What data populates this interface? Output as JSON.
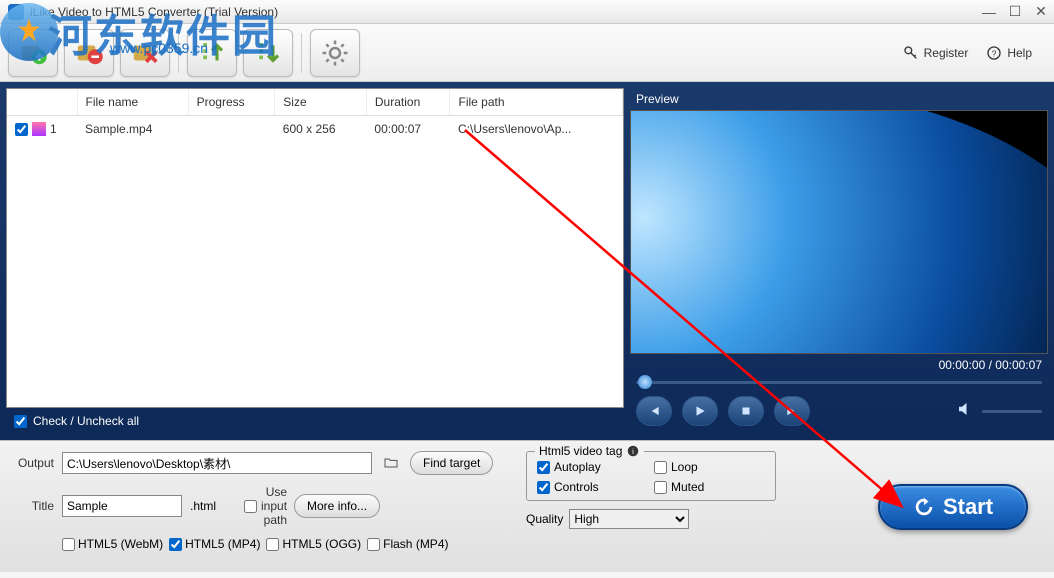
{
  "window": {
    "title": "iLike Video to HTML5 Converter (Trial Version)"
  },
  "watermark": {
    "text": "河东软件园",
    "url": "www.pc0359.cn"
  },
  "toolbar_links": {
    "register": "Register",
    "help": "Help"
  },
  "table": {
    "headers": {
      "filename": "File name",
      "progress": "Progress",
      "size": "Size",
      "duration": "Duration",
      "filepath": "File path"
    },
    "rows": [
      {
        "num": "1",
        "filename": "Sample.mp4",
        "progress": "",
        "size": "600 x 256",
        "duration": "00:00:07",
        "filepath": "C:\\Users\\lenovo\\Ap..."
      }
    ]
  },
  "check_all_label": "Check / Uncheck all",
  "preview": {
    "label": "Preview",
    "time": "00:00:00 / 00:00:07"
  },
  "bottom": {
    "output_label": "Output",
    "output_path": "C:\\Users\\lenovo\\Desktop\\素材\\",
    "find_target": "Find target",
    "title_label": "Title",
    "title_value": "Sample",
    "title_ext": ".html",
    "use_input_path": "Use input path",
    "more_info": "More info...",
    "formats": {
      "webm": "HTML5 (WebM)",
      "mp4": "HTML5 (MP4)",
      "ogg": "HTML5 (OGG)",
      "flash": "Flash (MP4)"
    },
    "html5_legend": "Html5 video tag",
    "html5_opts": {
      "autoplay": "Autoplay",
      "loop": "Loop",
      "controls": "Controls",
      "muted": "Muted"
    },
    "quality_label": "Quality",
    "quality_value": "High",
    "start": "Start"
  }
}
